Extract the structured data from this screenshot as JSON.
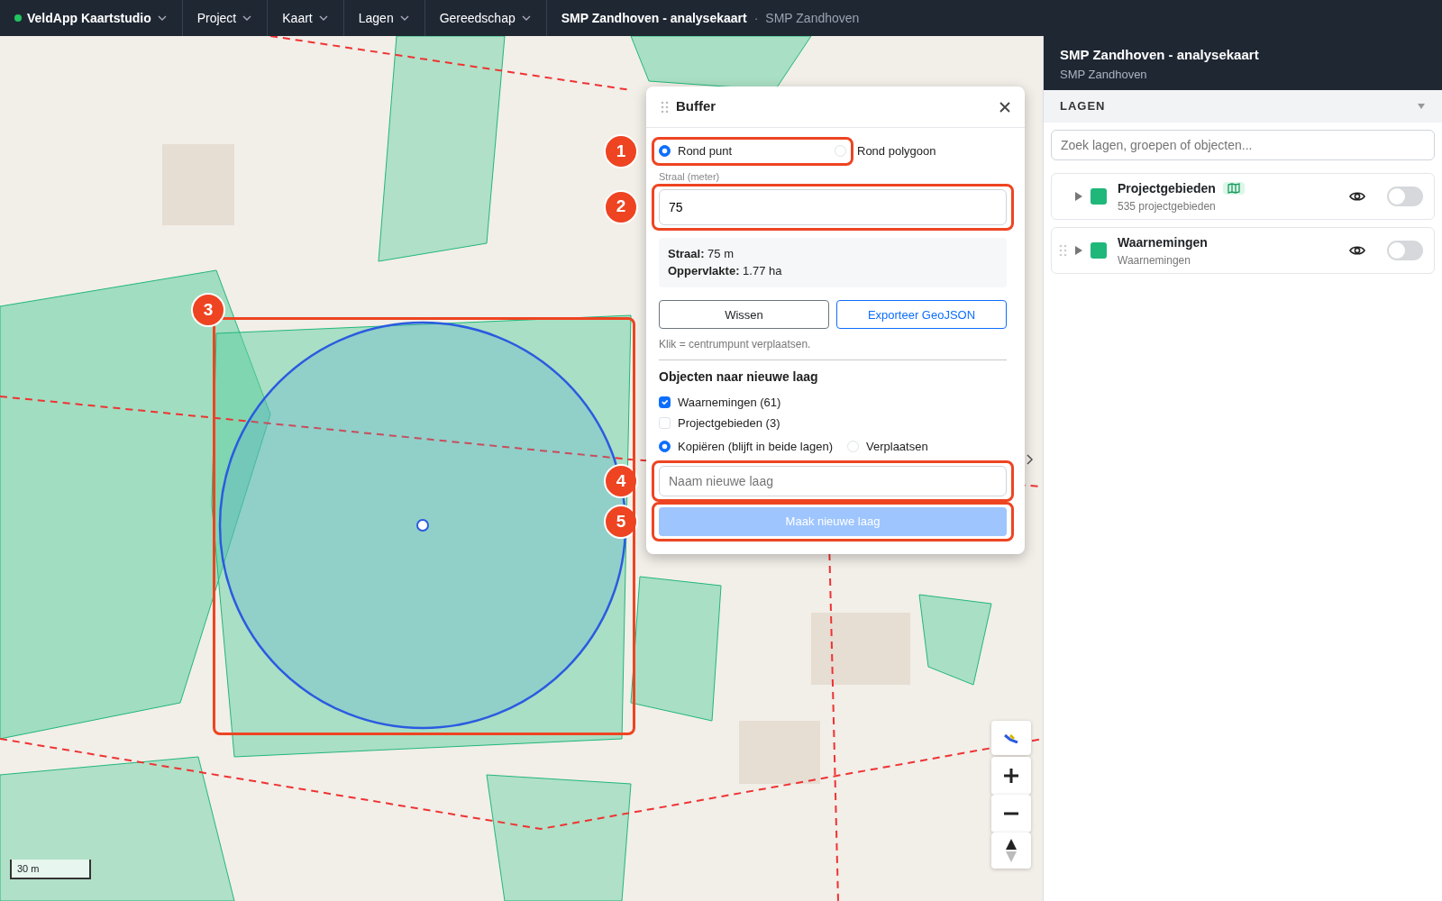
{
  "navbar": {
    "brand": "VeldApp Kaartstudio",
    "online": true,
    "menus": [
      "Project",
      "Kaart",
      "Lagen",
      "Gereedschap"
    ],
    "title": "SMP Zandhoven - analysekaart",
    "separator": "·",
    "subtitle": "SMP Zandhoven"
  },
  "map": {
    "kind": "picture",
    "scale": "30 m"
  },
  "buffer_panel": {
    "title": "Buffer",
    "modes": [
      {
        "label": "Rond punt",
        "selected": true
      },
      {
        "label": "Rond polygoon",
        "selected": false
      }
    ],
    "radius_label": "Straal (meter)",
    "radius_value": "75",
    "summary": [
      "**Straal:** 75 m",
      "**Oppervlakte:** 1.77 ha"
    ],
    "buttons": [
      {
        "label": "Wissen",
        "kind": "secondary"
      },
      {
        "label": "Exporteer GeoJSON",
        "kind": "primary"
      }
    ],
    "hint": "Klik = centrumpunt verplaatsen.",
    "section": "Objecten naar nieuwe laag",
    "layers": [
      {
        "label": "Waarnemingen (61)",
        "checked": true
      },
      {
        "label": "Projectgebieden (3)",
        "checked": false
      }
    ],
    "actions": [
      {
        "label": "Kopiëren (blijft in beide lagen)",
        "selected": true
      },
      {
        "label": "Verplaatsen",
        "selected": false
      }
    ],
    "name_placeholder": "Naam nieuwe laag",
    "create": {
      "label": "Maak nieuwe laag",
      "disabled": true
    }
  },
  "annotations": [
    {
      "number": "1"
    },
    {
      "number": "2"
    },
    {
      "number": "3"
    },
    {
      "number": "4"
    },
    {
      "number": "5"
    }
  ],
  "sidebar": {
    "title": "SMP Zandhoven - analysekaart",
    "subtitle": "SMP Zandhoven",
    "section": "LAGEN",
    "expanded": true,
    "search_placeholder": "Zoek lagen, groepen of objecten...",
    "layers": [
      {
        "name": "Projectgebieden",
        "detail": "535 projectgebieden",
        "color": "#20b77a",
        "kind": "area",
        "on": false
      },
      {
        "name": "Waarnemingen",
        "detail": "Waarnemingen",
        "color": "#20b77a",
        "kind": "points",
        "on": false
      }
    ]
  }
}
